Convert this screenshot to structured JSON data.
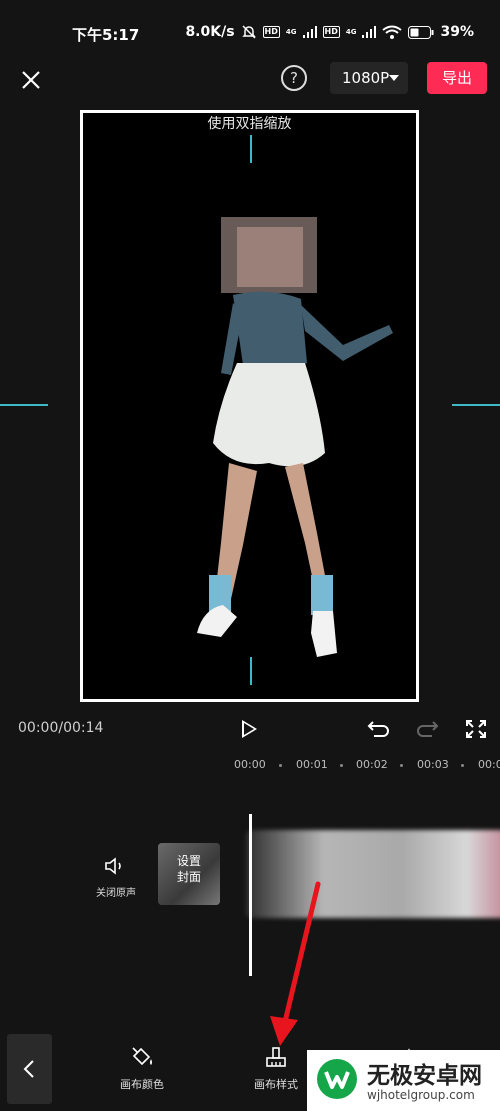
{
  "status": {
    "time": "下午5:17",
    "speed": "8.0K/s",
    "hd1": "HD",
    "hd2": "HD",
    "net1": "4G",
    "net2": "4G",
    "battery": "39%"
  },
  "topbar": {
    "help_label": "?",
    "resolution": "1080P",
    "export_label": "导出"
  },
  "preview": {
    "hint": "使用双指缩放"
  },
  "player": {
    "timecode": "00:00/00:14"
  },
  "timeline": {
    "ruler": [
      "00:00",
      "00:01",
      "00:02",
      "00:03",
      "00:0"
    ],
    "mute_label": "关闭原声",
    "cover_label": "设置\n封面"
  },
  "bottom_tools": [
    {
      "label": "画布颜色",
      "icon": "paint-bucket-icon"
    },
    {
      "label": "画布样式",
      "icon": "brush-icon"
    },
    {
      "label": "",
      "icon": "triangle-icon"
    }
  ],
  "watermark": {
    "title": "无极安卓网",
    "url": "wjhotelgroup.com"
  },
  "colors": {
    "accent": "#fe2c55",
    "guide": "#3fb9c8",
    "bg": "#141414"
  }
}
